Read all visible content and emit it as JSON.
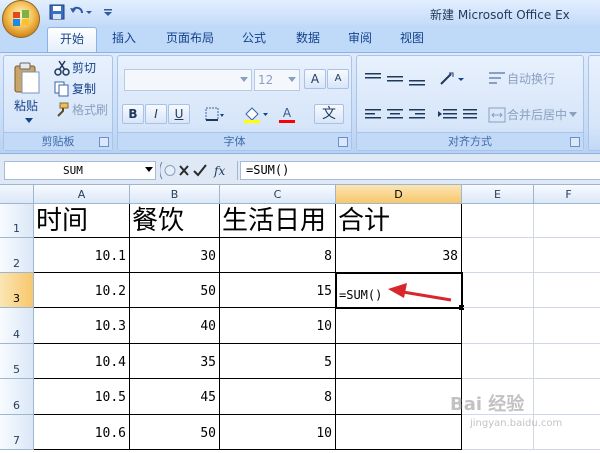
{
  "window": {
    "title": "新建 Microsoft Office Ex"
  },
  "tabs": [
    {
      "label": "开始",
      "active": true
    },
    {
      "label": "插入"
    },
    {
      "label": "页面布局"
    },
    {
      "label": "公式"
    },
    {
      "label": "数据"
    },
    {
      "label": "审阅"
    },
    {
      "label": "视图"
    }
  ],
  "ribbon": {
    "clipboard": {
      "label": "剪贴板",
      "paste": "粘贴",
      "cut": "剪切",
      "copy": "复制",
      "format_painter": "格式刷"
    },
    "font": {
      "label": "字体",
      "font_name": "",
      "font_size": "12",
      "grow": "A",
      "shrink": "A",
      "bold": "B",
      "italic": "I",
      "underline": "U",
      "font_color": "A",
      "phonetic": "文"
    },
    "alignment": {
      "label": "对齐方式",
      "wrap_text": "自动换行",
      "merge_center": "合并后居中"
    }
  },
  "formula_bar": {
    "name_box": "SUM",
    "fx": "fx",
    "formula": "=SUM()"
  },
  "grid": {
    "columns": [
      "A",
      "B",
      "C",
      "D",
      "E",
      "F"
    ],
    "rows": [
      "1",
      "2",
      "3",
      "4",
      "5",
      "6",
      "7"
    ],
    "selected_column": "D",
    "selected_row": "3",
    "cells": {
      "headers": [
        "时间",
        "餐饮",
        "生活日用",
        "合计"
      ],
      "r2": [
        "10.1",
        "30",
        "8",
        "38"
      ],
      "r3": [
        "10.2",
        "50",
        "15",
        "=SUM()"
      ],
      "r4": [
        "10.3",
        "40",
        "10",
        ""
      ],
      "r5": [
        "10.4",
        "35",
        "5",
        ""
      ],
      "r6": [
        "10.5",
        "45",
        "8",
        ""
      ],
      "r7": [
        "10.6",
        "50",
        "10",
        ""
      ]
    }
  },
  "annotation": {
    "arrow_color": "#d9262a"
  },
  "watermark": {
    "text": "Bai 经验",
    "sub": "jingyan.baidu.com"
  }
}
